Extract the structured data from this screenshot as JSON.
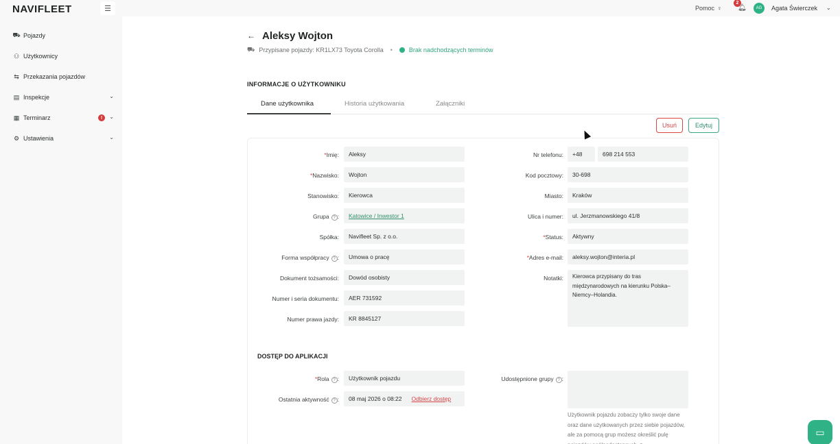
{
  "app": {
    "logo": "NAVIFLEET"
  },
  "sidebar": {
    "items": [
      {
        "label": "Pojazdy",
        "icon": "car-icon"
      },
      {
        "label": "Użytkownicy",
        "icon": "users-icon"
      },
      {
        "label": "Przekazania pojazdów",
        "icon": "swap-icon"
      },
      {
        "label": "Inspekcje",
        "icon": "clipboard-icon"
      },
      {
        "label": "Terminarz",
        "icon": "calendar-icon",
        "badge": "!"
      },
      {
        "label": "Ustawienia",
        "icon": "gear-icon"
      }
    ]
  },
  "topbar": {
    "help": "Pomoc",
    "notifications": "2",
    "avatar_initials": "AG",
    "user_name": "Agata Świerczek"
  },
  "page": {
    "title": "Aleksy Wojton",
    "assigned": "Przypisane pojazdy: KR1LX73 Toyota Corolla",
    "sep": "•",
    "status_text": "Brak nadchodzących terminów",
    "section_title": "INFORMACJE O UŻYTKOWNIKU",
    "tabs": [
      "Dane użytkownika",
      "Historia użytkowania",
      "Załączniki"
    ],
    "delete_label": "Usuń",
    "edit_label": "Edytuj"
  },
  "colors": {
    "accent": "#2fb386",
    "danger": "#d64545"
  },
  "form": {
    "left": [
      {
        "label": "Imię:",
        "required": true,
        "value": "Aleksy"
      },
      {
        "label": "Nazwisko:",
        "required": true,
        "value": "Wojton"
      },
      {
        "label": "Stanowisko:",
        "value": "Kierowca"
      },
      {
        "label": "Grupa",
        "help": true,
        "value": "Katowice / Inwestor 1",
        "link": true
      },
      {
        "label": "Spółka:",
        "value": "Navifleet Sp. z o.o."
      },
      {
        "label": "Forma współpracy",
        "help": true,
        "value": "Umowa o pracę"
      },
      {
        "label": "Dokument tożsamości:",
        "value": "Dowód osobisty"
      },
      {
        "label": "Numer i seria dokumentu:",
        "value": "AER 731592"
      },
      {
        "label": "Numer prawa jazdy:",
        "value": "KR 8845127"
      }
    ],
    "right": {
      "phone_label": "Nr telefonu:",
      "phone_prefix": "+48",
      "phone_number": "698 214 553",
      "zip_label": "Kod pocztowy:",
      "zip": "30-698",
      "city_label": "Miasto:",
      "city": "Kraków",
      "street_label": "Ulica i numer:",
      "street": "ul. Jerzmanowskiego 41/8",
      "status_label": "Status:",
      "status": "Aktywny",
      "email_label": "Adres e-mail:",
      "email": "aleksy.wojton@interia.pl",
      "notes_label": "Notatki:",
      "notes": "Kierowca przypisany do tras międzynarodowych na kierunku Polska–Niemcy–Holandia."
    }
  },
  "access": {
    "title": "DOSTĘP DO APLIKACJI",
    "role_label": "Rola",
    "role": "Użytkownik pojazdu",
    "last_active_label": "Ostatnia aktywność",
    "last_active": "08 maj 2026 o 08:22",
    "revoke": "Odbierz dostęp",
    "groups_label": "Udostępnione grupy",
    "groups_help": "Użytkownik pojazdu zobaczy tylko swoje dane oraz dane użytkowanych przez siebie pojazdów, ale za pomocą grup możesz określić pulę pojazdów ogólnodostępnych, z"
  }
}
